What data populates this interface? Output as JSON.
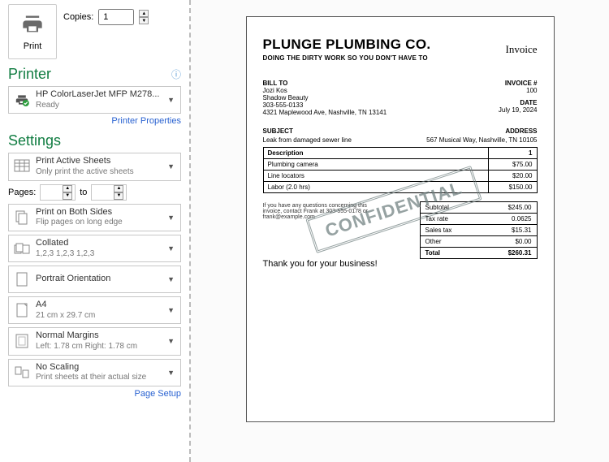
{
  "print": {
    "button_label": "Print",
    "copies_label": "Copies:",
    "copies_value": "1"
  },
  "printer_section": {
    "title": "Printer",
    "name": "HP ColorLaserJet MFP M278...",
    "status": "Ready",
    "properties_link": "Printer Properties"
  },
  "settings_section": {
    "title": "Settings",
    "pages_label": "Pages:",
    "pages_to": "to",
    "page_setup_link": "Page Setup",
    "items": [
      {
        "main": "Print Active Sheets",
        "sub": "Only print the active sheets"
      },
      {
        "main": "Print on Both Sides",
        "sub": "Flip pages on long edge"
      },
      {
        "main": "Collated",
        "sub": "1,2,3   1,2,3   1,2,3"
      },
      {
        "main": "Portrait Orientation",
        "sub": ""
      },
      {
        "main": "A4",
        "sub": "21 cm x 29.7 cm"
      },
      {
        "main": "Normal Margins",
        "sub": "Left:  1.78 cm    Right:  1.78 cm"
      },
      {
        "main": "No Scaling",
        "sub": "Print sheets at their actual size"
      }
    ]
  },
  "invoice": {
    "company": "PLUNGE PLUMBING CO.",
    "tagline": "DOING THE DIRTY WORK SO YOU DON'T HAVE TO",
    "doc_title": "Invoice",
    "bill_to_label": "BILL TO",
    "bill_to_name": "Jozi Kos",
    "bill_to_company": "Shadow Beauty",
    "bill_to_phone": "303-555-0133",
    "bill_to_address": "4321 Maplewood Ave, Nashville, TN 13141",
    "invoice_num_label": "INVOICE #",
    "invoice_num": "100",
    "date_label": "DATE",
    "date": "July 19, 2024",
    "subject_label": "SUBJECT",
    "subject": "Leak from damaged sewer line",
    "address_label": "ADDRESS",
    "service_address": "567 Musical Way, Nashville, TN 10105",
    "headers": {
      "desc": "Description",
      "qty": "1"
    },
    "lines": [
      {
        "desc": "Plumbing camera",
        "amount": "$75.00"
      },
      {
        "desc": "Line locators",
        "amount": "$20.00"
      },
      {
        "desc": "Labor (2.0 hrs)",
        "amount": "$150.00"
      }
    ],
    "totals": [
      {
        "label": "Subtotal",
        "value": "$245.00"
      },
      {
        "label": "Tax  rate",
        "value": "0.0625"
      },
      {
        "label": "Sales tax",
        "value": "$15.31"
      },
      {
        "label": "Other",
        "value": "$0.00"
      },
      {
        "label": "Total",
        "value": "$260.31"
      }
    ],
    "questions": "If you have any questions concerning this invoice, contact Frank at 303-555-0178 or frank@example.com",
    "thanks": "Thank you for your business!",
    "stamp": "CONFIDENTIAL"
  }
}
